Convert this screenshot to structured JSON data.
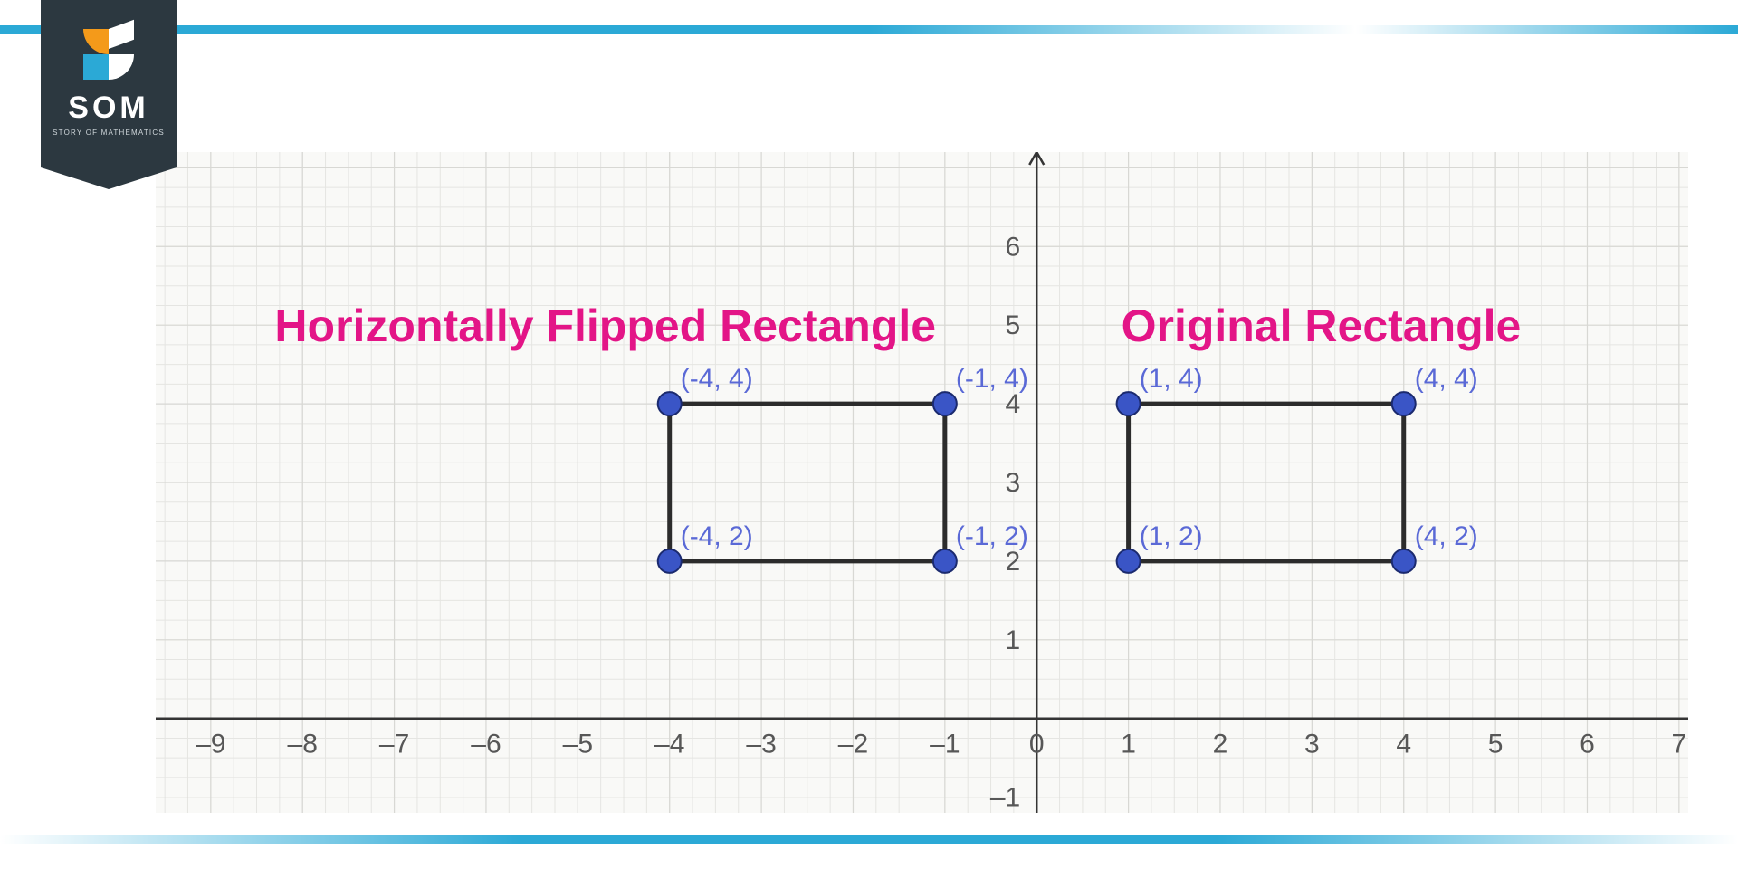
{
  "logo": {
    "name": "SOM",
    "tagline": "STORY OF MATHEMATICS"
  },
  "chart_data": {
    "type": "scatter",
    "title_left": "Horizontally Flipped Rectangle",
    "title_right": "Original Rectangle",
    "x_ticks": [
      "–9",
      "–8",
      "–7",
      "–6",
      "–5",
      "–4",
      "–3",
      "–2",
      "–1",
      "0",
      "1",
      "2",
      "3",
      "4",
      "5",
      "6",
      "7"
    ],
    "x_tick_values": [
      -9,
      -8,
      -7,
      -6,
      -5,
      -4,
      -3,
      -2,
      -1,
      0,
      1,
      2,
      3,
      4,
      5,
      6,
      7
    ],
    "y_ticks": [
      "–1",
      "1",
      "2",
      "3",
      "4",
      "5",
      "6"
    ],
    "y_tick_values": [
      -1,
      1,
      2,
      3,
      4,
      5,
      6
    ],
    "xlim": [
      -9.6,
      7.1
    ],
    "ylim": [
      -1.2,
      7.2
    ],
    "rectangles": [
      {
        "label": "flipped",
        "vertices": [
          {
            "x": -4,
            "y": 4,
            "label": "(-4, 4)"
          },
          {
            "x": -1,
            "y": 4,
            "label": "(-1, 4)"
          },
          {
            "x": -1,
            "y": 2,
            "label": "(-1, 2)"
          },
          {
            "x": -4,
            "y": 2,
            "label": "(-4, 2)"
          }
        ]
      },
      {
        "label": "original",
        "vertices": [
          {
            "x": 1,
            "y": 4,
            "label": "(1, 4)"
          },
          {
            "x": 4,
            "y": 4,
            "label": "(4, 4)"
          },
          {
            "x": 4,
            "y": 2,
            "label": "(4, 2)"
          },
          {
            "x": 1,
            "y": 2,
            "label": "(1, 2)"
          }
        ]
      }
    ]
  }
}
